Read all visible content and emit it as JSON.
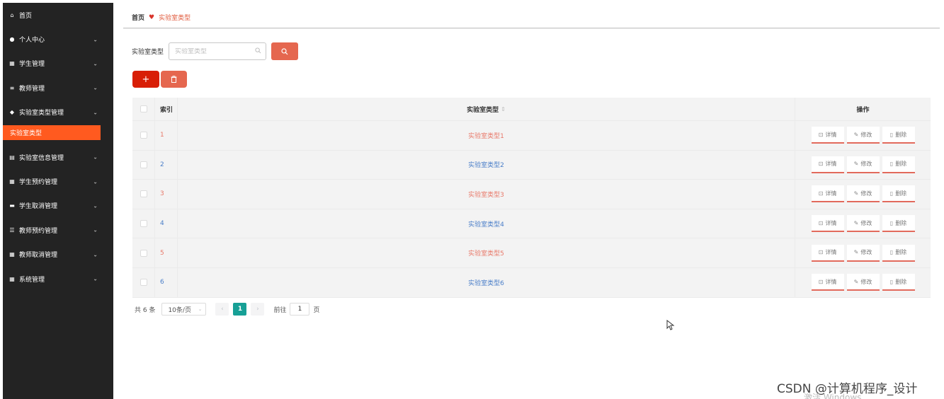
{
  "sidebar": {
    "items": [
      {
        "label": "首页",
        "icon": "home-icon",
        "glyph": "⌂",
        "has_arrow": false
      },
      {
        "label": "个人中心",
        "icon": "user-icon",
        "glyph": "●",
        "has_arrow": true
      },
      {
        "label": "学生管理",
        "icon": "grid-icon",
        "glyph": "▦",
        "has_arrow": true
      },
      {
        "label": "教师管理",
        "icon": "list-icon",
        "glyph": "≡",
        "has_arrow": true
      },
      {
        "label": "实验室类型管理",
        "icon": "shield-icon",
        "glyph": "◆",
        "has_arrow": true
      },
      {
        "label": "实验室信息管理",
        "icon": "table-icon",
        "glyph": "▤",
        "has_arrow": true
      },
      {
        "label": "学生预约管理",
        "icon": "grid-icon",
        "glyph": "▦",
        "has_arrow": true
      },
      {
        "label": "学生取消管理",
        "icon": "ticket-icon",
        "glyph": "▬",
        "has_arrow": true
      },
      {
        "label": "教师预约管理",
        "icon": "sliders-icon",
        "glyph": "☰",
        "has_arrow": true
      },
      {
        "label": "教师取消管理",
        "icon": "grid-icon",
        "glyph": "▦",
        "has_arrow": true
      },
      {
        "label": "系统管理",
        "icon": "grid-icon",
        "glyph": "▦",
        "has_arrow": true
      }
    ],
    "active_sub": "实验室类型",
    "active_after_index": 4,
    "arrow_glyph": "⌄"
  },
  "breadcrumb": {
    "home": "首页",
    "separator_glyph": "♥",
    "current": "实验室类型"
  },
  "search": {
    "label": "实验室类型",
    "placeholder": "实验室类型",
    "value": "",
    "input_icon": "search-icon",
    "button_icon": "search-icon"
  },
  "actions": {
    "add_glyph": "+",
    "delete_icon": "trash-icon"
  },
  "table": {
    "headers": {
      "index": "索引",
      "type": "实验室类型",
      "ops": "操作"
    },
    "rows": [
      {
        "index": "1",
        "type": "实验室类型1"
      },
      {
        "index": "2",
        "type": "实验室类型2"
      },
      {
        "index": "3",
        "type": "实验室类型3"
      },
      {
        "index": "4",
        "type": "实验室类型4"
      },
      {
        "index": "5",
        "type": "实验室类型5"
      },
      {
        "index": "6",
        "type": "实验室类型6"
      }
    ],
    "row_actions": {
      "detail": "详情",
      "edit": "修改",
      "delete": "删除"
    }
  },
  "pagination": {
    "total": "共 6 条",
    "page_size": "10条/页",
    "current_page": "1",
    "goto_label": "前往",
    "goto_value": "1",
    "page_suffix": "页"
  },
  "watermark": "CSDN @计算机程序_设计",
  "windows_activation": "激活 Windows",
  "colors": {
    "sidebar_bg": "#232323",
    "active_sub": "#ff5a1f",
    "search_btn": "#e5674f",
    "add_btn": "#d81e06",
    "page_active": "#17a096",
    "link_odd": "#e8796a",
    "link_even": "#4a7ec8"
  }
}
